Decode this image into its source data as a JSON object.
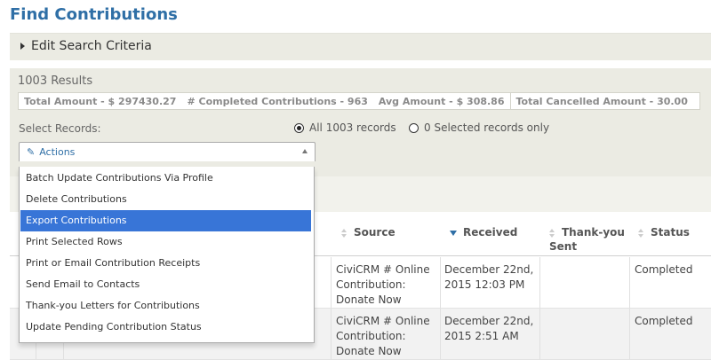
{
  "page": {
    "title": "Find Contributions"
  },
  "search_criteria": {
    "label": "Edit Search Criteria"
  },
  "results": {
    "count_text": "1003 Results",
    "stats": [
      "Total Amount - $ 297430.27",
      "# Completed Contributions - 963",
      "Avg Amount - $ 308.86",
      "Total Cancelled Amount - 30.00"
    ],
    "select_label": "Select Records:",
    "radio_all": "All 1003 records",
    "radio_selected": "0 Selected records only",
    "radio_all_checked": true
  },
  "actions": {
    "label": "Actions",
    "items": [
      "Batch Update Contributions Via Profile",
      "Delete Contributions",
      "Export Contributions",
      "Print Selected Rows",
      "Print or Email Contribution Receipts",
      "Send Email to Contacts",
      "Thank-you Letters for Contributions",
      "Update Pending Contribution Status"
    ],
    "highlighted_item": "Export Contributions"
  },
  "table": {
    "headers": {
      "source": "Source",
      "received": "Received",
      "thankyou_line1": "Thank-you",
      "thankyou_line2": "Sent",
      "status": "Status"
    },
    "sorted_column": "Received",
    "rows": [
      {
        "source_l1": "CiviCRM # Online",
        "source_l2": "Contribution:",
        "source_l3": "Donate Now",
        "received_l1": "December 22nd,",
        "received_l2": "2015 12:03 PM",
        "thankyou": "",
        "status": "Completed"
      },
      {
        "source_l1": "CiviCRM # Online",
        "source_l2": "Contribution:",
        "source_l3": "Donate Now",
        "received_l1": "December 22nd,",
        "received_l2": "2015 2:51 AM",
        "thankyou": "",
        "status": "Completed"
      }
    ]
  },
  "colors": {
    "accent": "#2f6fa6",
    "highlight": "#3875d7",
    "panel": "#ebebe3"
  }
}
